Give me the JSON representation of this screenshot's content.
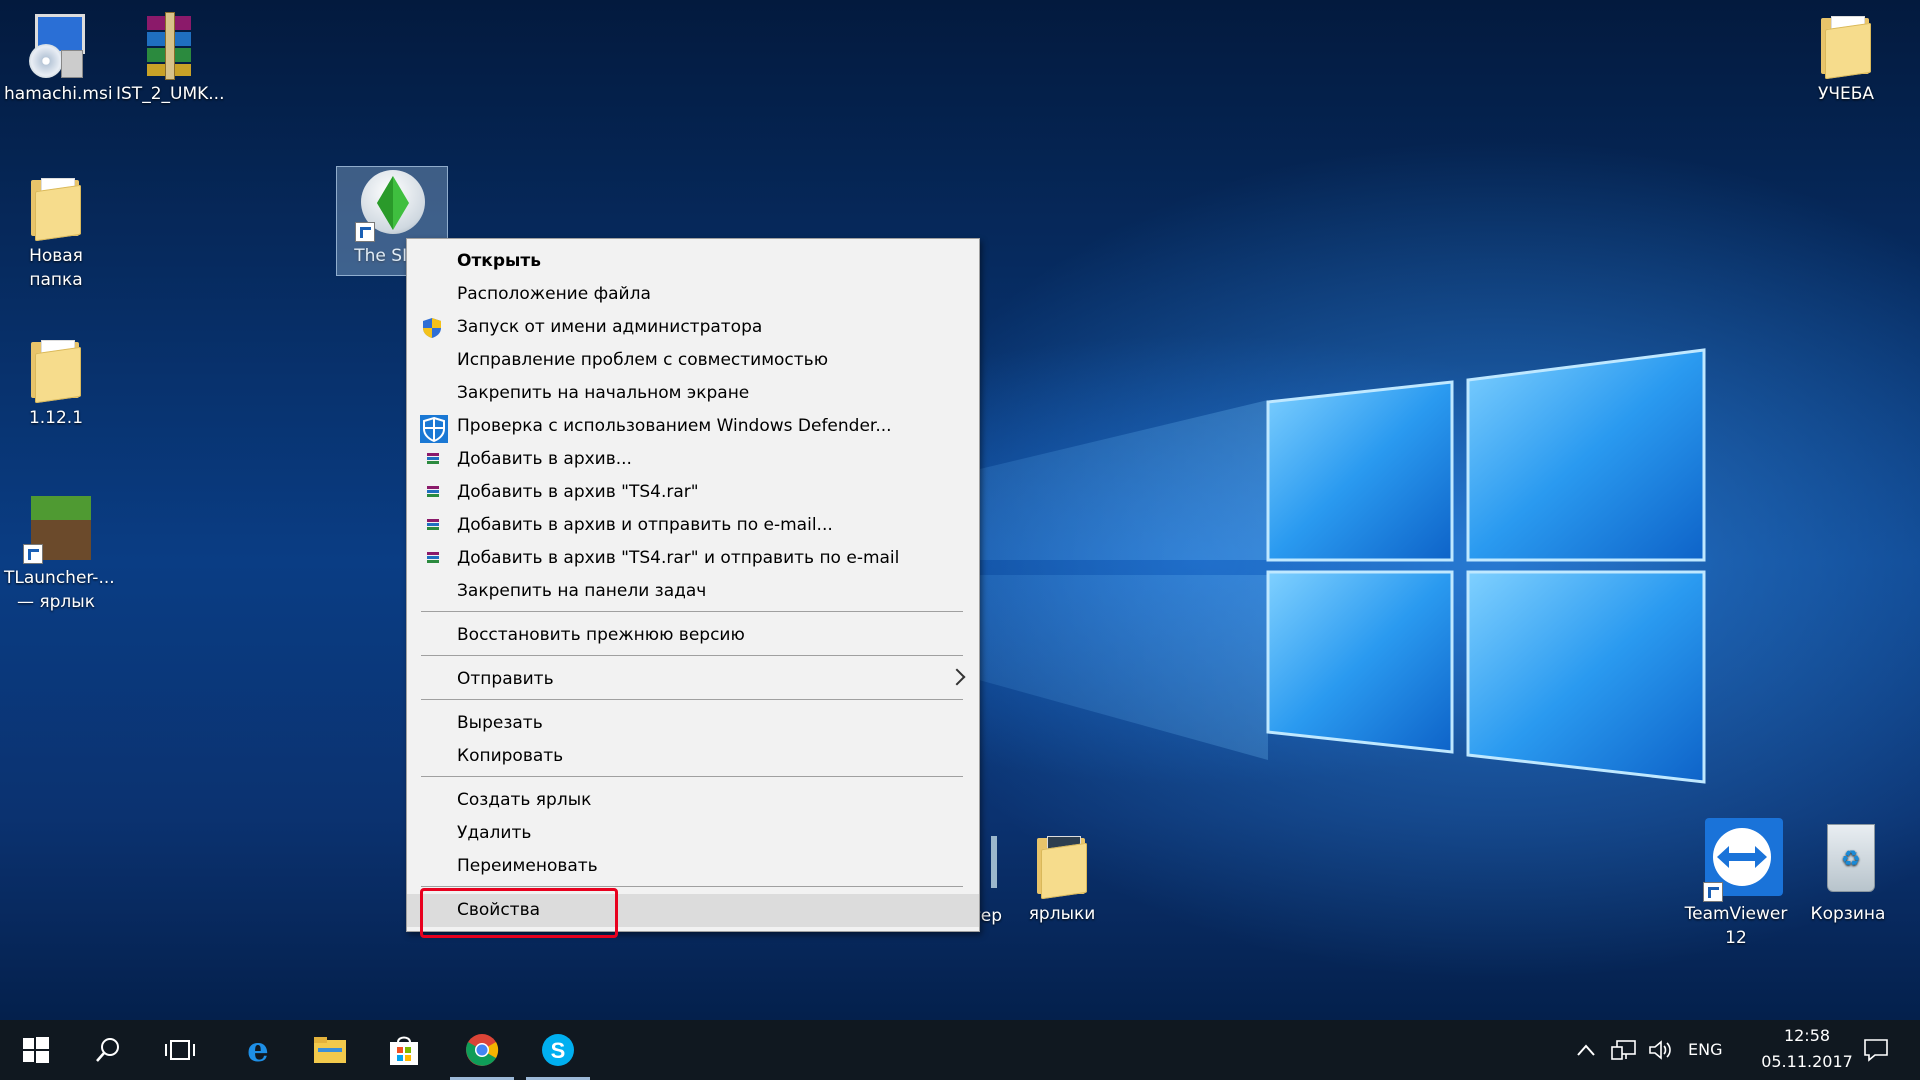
{
  "desktop_icons": {
    "hamachi": "hamachi.msi",
    "ist": "IST_2_UMK...",
    "ucheba": "УЧЕБА",
    "new_folder": "Новая папка",
    "sims": "The SIM",
    "v1121": "1.12.1",
    "tlauncher_line1": "TLauncher-...",
    "tlauncher_line2": "— ярлык",
    "computer": "компьютер",
    "yarlyki": "ярлыки",
    "teamviewer_line1": "TeamViewer",
    "teamviewer_line2": "12",
    "recycle": "Корзина"
  },
  "context_menu": {
    "open": "Открыть",
    "file_location": "Расположение файла",
    "run_as_admin": "Запуск от имени администратора",
    "troubleshoot": "Исправление проблем с совместимостью",
    "pin_start": "Закрепить на начальном экране",
    "defender_scan": "Проверка с использованием Windows Defender...",
    "add_archive": "Добавить в архив...",
    "add_ts4": "Добавить в архив \"TS4.rar\"",
    "add_archive_email": "Добавить в архив и отправить по e-mail...",
    "add_ts4_email": "Добавить в архив \"TS4.rar\" и отправить по e-mail",
    "pin_taskbar": "Закрепить на панели задач",
    "restore_prev": "Восстановить прежнюю версию",
    "send_to": "Отправить",
    "cut": "Вырезать",
    "copy": "Копировать",
    "create_shortcut": "Создать ярлык",
    "delete": "Удалить",
    "rename": "Переименовать",
    "properties": "Свойства"
  },
  "taskbar": {
    "language": "ENG",
    "time": "12:58",
    "date": "05.11.2017"
  },
  "colors": {
    "accent_red": "#e8001e",
    "taskbar": "#101820",
    "menu_bg": "#f2f2f2"
  }
}
